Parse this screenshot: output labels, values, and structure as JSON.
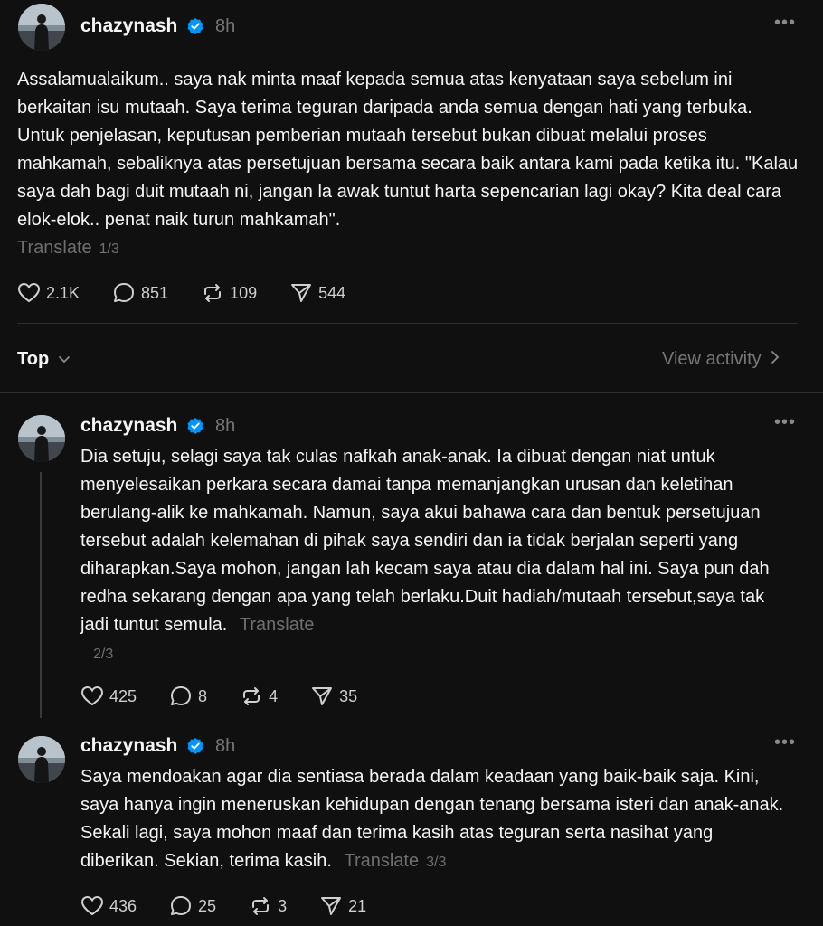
{
  "main_post": {
    "username": "chazynash",
    "time": "8h",
    "text": "Assalamualaikum.. saya nak minta maaf kepada semua atas kenyataan saya sebelum ini berkaitan isu mutaah. Saya terima teguran daripada anda semua dengan hati yang terbuka. Untuk penjelasan, keputusan pemberian mutaah tersebut bukan dibuat melalui proses mahkamah, sebaliknya atas persetujuan bersama secara baik antara kami pada ketika itu. \"Kalau saya dah bagi duit mutaah ni, jangan la awak tuntut harta sepencarian lagi okay? Kita deal cara elok-elok.. penat naik turun mahkamah\".",
    "translate": "Translate",
    "pager": "1/3",
    "likes": "2.1K",
    "comments": "851",
    "reposts": "109",
    "shares": "544"
  },
  "sort_bar": {
    "label": "Top",
    "view_activity": "View activity"
  },
  "reply_1": {
    "username": "chazynash",
    "time": "8h",
    "text": "Dia setuju, selagi saya tak culas nafkah anak-anak. Ia dibuat dengan niat untuk menyelesaikan perkara secara damai tanpa memanjangkan urusan dan keletihan berulang-alik ke mahkamah. Namun, saya akui bahawa cara dan bentuk persetujuan tersebut adalah kelemahan di pihak saya sendiri dan ia tidak berjalan seperti yang diharapkan.Saya mohon, jangan lah kecam saya atau dia dalam hal ini. Saya pun dah redha sekarang dengan apa yang telah berlaku.Duit hadiah/mutaah tersebut,saya tak jadi tuntut semula.",
    "translate": "Translate",
    "pager": "2/3",
    "likes": "425",
    "comments": "8",
    "reposts": "4",
    "shares": "35"
  },
  "reply_2": {
    "username": "chazynash",
    "time": "8h",
    "text": "Saya mendoakan agar dia sentiasa berada dalam keadaan yang baik-baik saja. Kini, saya hanya ingin meneruskan kehidupan dengan tenang bersama isteri dan anak-anak. Sekali lagi, saya mohon maaf dan terima kasih atas teguran serta nasihat yang diberikan. Sekian, terima kasih.",
    "translate": "Translate",
    "pager": "3/3",
    "likes": "436",
    "comments": "25",
    "reposts": "3",
    "shares": "21"
  },
  "colors": {
    "background": "#101010",
    "verified": "#0095f6",
    "muted": "#777777"
  }
}
